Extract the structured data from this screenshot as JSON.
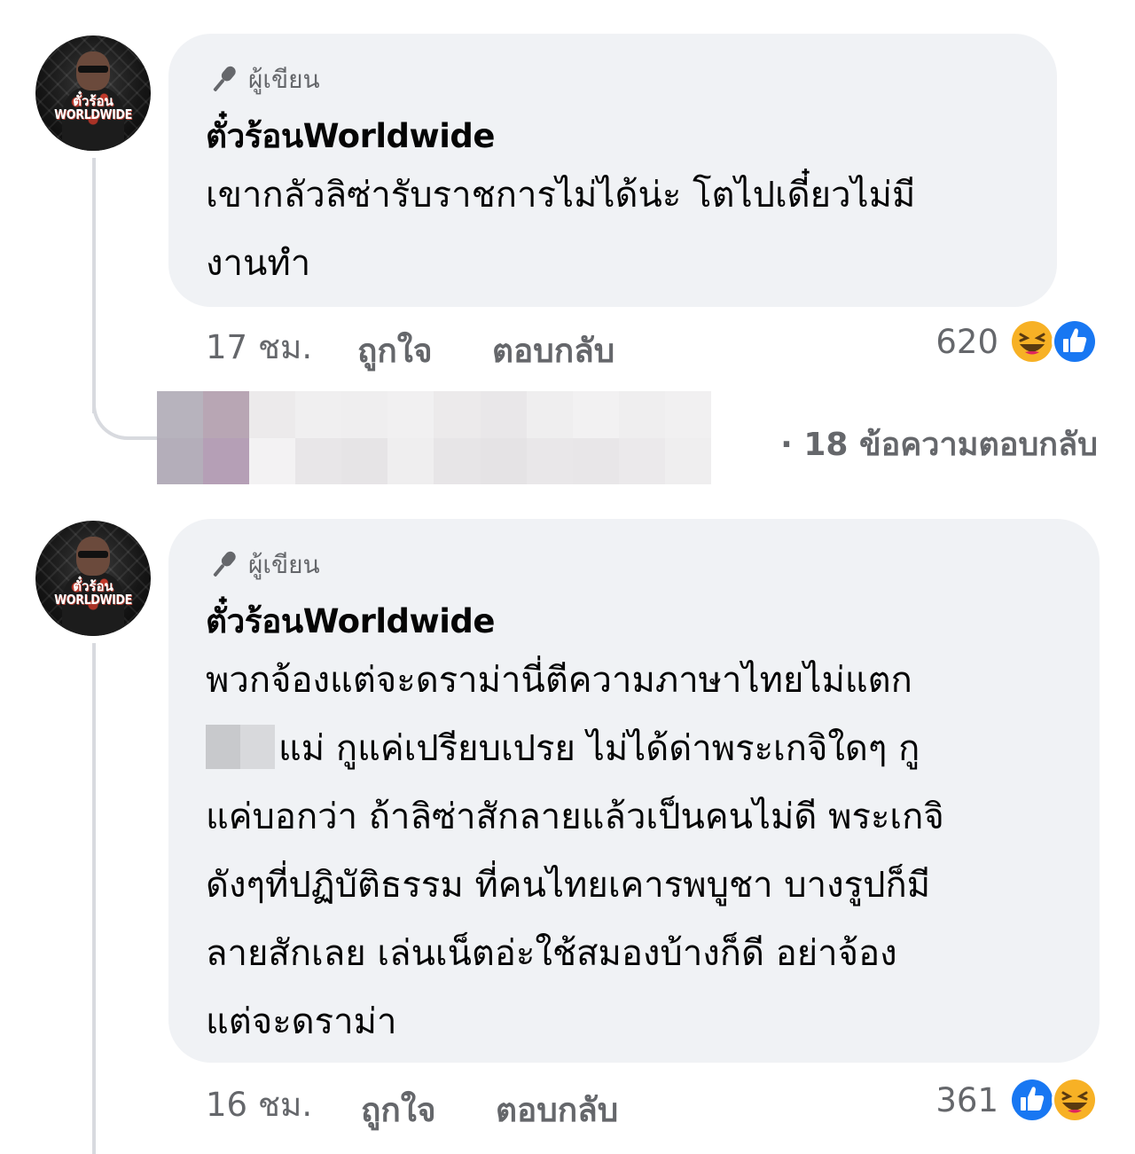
{
  "comments": [
    {
      "author_badge": "ผู้เขียน",
      "author_name": "ตั๋วร้อนWorldwide",
      "avatar_text": [
        "ตั๋วร้อน",
        "WORLDWIDE"
      ],
      "text_lines": [
        "เขากลัวลิซ่ารับราชการไม่ได้น่ะ โตไปเดี๋ยวไม่มี",
        "งานทำ"
      ],
      "time": "17 ชม.",
      "like_label": "ถูกใจ",
      "reply_label": "ตอบกลับ",
      "reaction_count": "620",
      "reactions": [
        "haha-icon",
        "like-icon"
      ]
    },
    {
      "author_badge": "ผู้เขียน",
      "author_name": "ตั๋วร้อนWorldwide",
      "avatar_text": [
        "ตั๋วร้อน",
        "WORLDWIDE"
      ],
      "text_lines": [
        "พวกจ้องแต่จะดราม่านี่ตีความภาษาไทยไม่แตก",
        "แม่ กูแค่เปรียบเปรย ไม่ได้ด่าพระเกจิใดๆ กู",
        "แค่บอกว่า ถ้าลิซ่าสักลายแล้วเป็นคนไม่ดี พระเกจิ",
        "ดังๆที่ปฏิบัติธรรม ที่คนไทยเคารพบูชา บางรูปก็มี",
        "ลายสักเลย เล่นเน็ตอ่ะใช้สมองบ้างก็ดี อย่าจ้อง",
        "แต่จะดราม่า"
      ],
      "time": "16 ชม.",
      "like_label": "ถูกใจ",
      "reply_label": "ตอบกลับ",
      "reaction_count": "361",
      "reactions": [
        "like-icon",
        "haha-icon"
      ]
    }
  ],
  "replies_link": "· 18 ข้อความตอบกลับ",
  "colors": {
    "bubble": "#f0f2f5",
    "meta_text": "#65676b",
    "like_blue": "#1877f2",
    "haha_yellow": "#f7b125"
  }
}
